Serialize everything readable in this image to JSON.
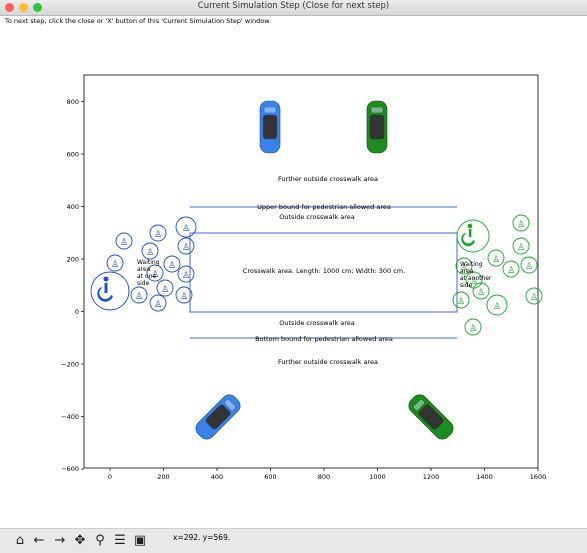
{
  "window": {
    "title": "Current Simulation Step (Close for next step)",
    "instruction": "To next step, click the close or 'X' button of this 'Current Simulation Step' window."
  },
  "plot": {
    "xticks": [
      "0",
      "200",
      "400",
      "600",
      "800",
      "1000",
      "1200",
      "1400",
      "1600"
    ],
    "yticks": [
      "800",
      "600",
      "400",
      "200",
      "0",
      "−200",
      "−400",
      "−600"
    ],
    "further_top": "Further outside crosswalk area",
    "upper_bound": "Upper bound for pedestrian allowed area",
    "outside_top": "Outside crosswalk area",
    "crosswalk": "Crosswalk area. Length: 1000 cm; Width: 300 cm.",
    "outside_bottom": "Outside crosswalk area",
    "lower_bound": "Bottom bound for pedestrian allowed area",
    "further_bottom": "Further outside crosswalk area",
    "left_waiting": [
      "Waiting",
      "area",
      "at one",
      "side"
    ],
    "right_waiting": [
      "Waiting",
      "area",
      "at another",
      "side"
    ]
  },
  "colors": {
    "crosswalk_line": "#3b6bd6",
    "left_group": "#1a4fc7",
    "right_group": "#1aa52a",
    "car_blue": "#3b82e6",
    "car_green": "#1f8a1f"
  },
  "toolbar": {
    "icons": [
      "home-icon",
      "back-arrow-icon",
      "forward-arrow-icon",
      "pan-icon",
      "zoom-icon",
      "configure-subplots-icon",
      "save-icon"
    ],
    "coords": "x=292. y=569."
  }
}
